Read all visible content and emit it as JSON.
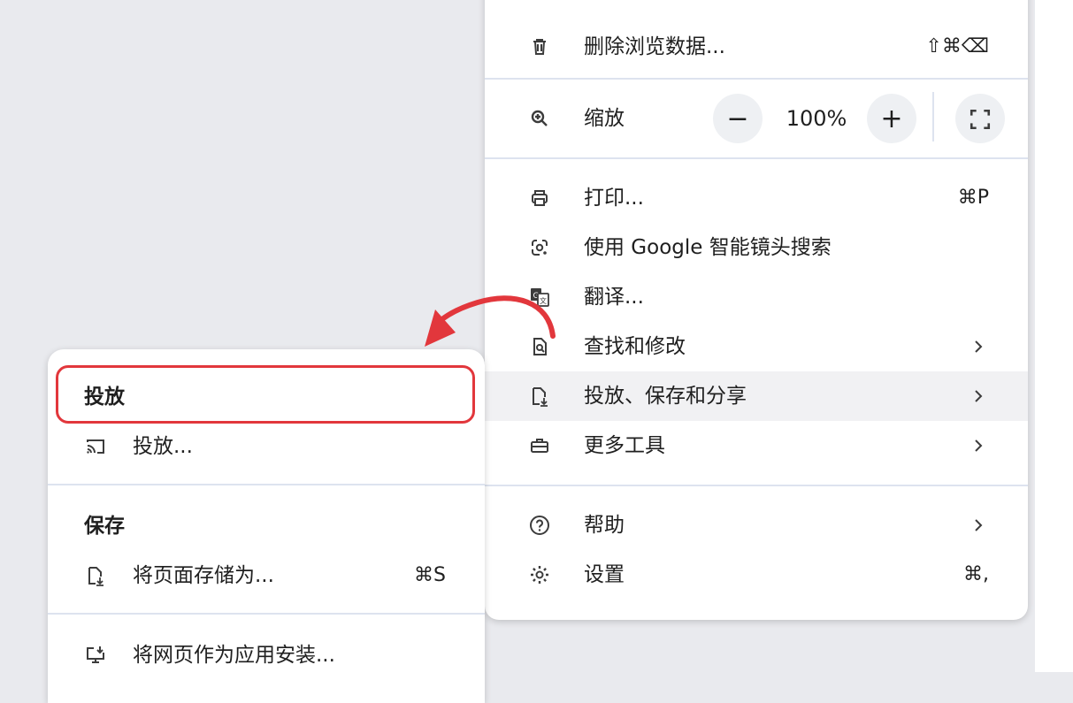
{
  "main_menu": {
    "items": {
      "clear_data": {
        "label": "删除浏览数据...",
        "shortcut": "⇧⌘⌫",
        "icon": "trash-icon"
      },
      "zoom": {
        "label": "缩放",
        "value": "100%",
        "minus": "−",
        "plus": "+",
        "icon": "zoom-icon"
      },
      "print": {
        "label": "打印...",
        "shortcut": "⌘P",
        "icon": "print-icon"
      },
      "google_lens": {
        "label": "使用 Google 智能镜头搜索",
        "icon": "lens-icon"
      },
      "translate": {
        "label": "翻译...",
        "icon": "translate-icon"
      },
      "find_edit": {
        "label": "查找和修改",
        "icon": "find-page-icon"
      },
      "cast_save_share": {
        "label": "投放、保存和分享",
        "icon": "save-page-icon"
      },
      "more_tools": {
        "label": "更多工具",
        "icon": "toolbox-icon"
      },
      "help": {
        "label": "帮助",
        "icon": "help-icon"
      },
      "settings": {
        "label": "设置",
        "shortcut": "⌘,",
        "icon": "gear-icon"
      }
    }
  },
  "sub_menu": {
    "cast_section_title": "投放",
    "cast_item": {
      "label": "投放...",
      "icon": "cast-icon"
    },
    "save_section_title": "保存",
    "save_page": {
      "label": "将页面存储为...",
      "shortcut": "⌘S",
      "icon": "save-page-icon"
    },
    "install_app": {
      "label": "将网页作为应用安装...",
      "icon": "install-icon"
    }
  },
  "annotation": {
    "color": "#e2373c"
  }
}
